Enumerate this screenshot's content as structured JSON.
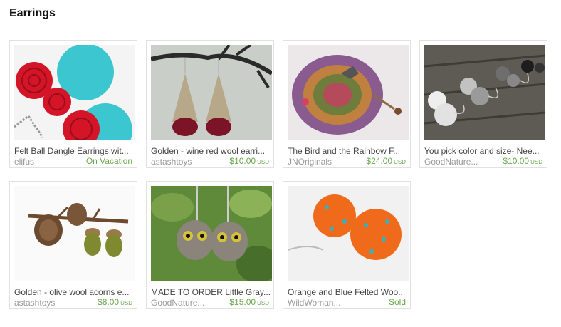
{
  "section": {
    "title": "Earrings"
  },
  "theme": {
    "price_color": "#6aa84f",
    "border_color": "#e1e1e1"
  },
  "listings": [
    {
      "title": "Felt Ball Dangle Earrings wit...",
      "shop": "elifus",
      "status": "On Vacation",
      "image_icon": "felt-ball-earrings-photo"
    },
    {
      "title": "Golden - wine red wool earri...",
      "shop": "astashtoys",
      "price": "$10.00",
      "currency": "USD",
      "image_icon": "crochet-cone-earrings-photo"
    },
    {
      "title": "The Bird and the Rainbow F...",
      "shop": "JNOriginals",
      "price": "$24.00",
      "currency": "USD",
      "image_icon": "crochet-pouch-photo"
    },
    {
      "title": "You pick color and size- Nee...",
      "shop": "GoodNature...",
      "price": "$10.00",
      "currency": "USD",
      "image_icon": "felt-ball-wood-photo"
    },
    {
      "title": "Golden - olive wool acorns e...",
      "shop": "astashtoys",
      "price": "$8.00",
      "currency": "USD",
      "image_icon": "acorn-earrings-photo"
    },
    {
      "title": "MADE TO ORDER Little Gray...",
      "shop": "GoodNature...",
      "price": "$15.00",
      "currency": "USD",
      "image_icon": "owl-earrings-photo"
    },
    {
      "title": "Orange and Blue Felted Woo...",
      "shop": "WildWoman...",
      "status": "Sold",
      "image_icon": "orange-felt-earrings-photo"
    }
  ]
}
